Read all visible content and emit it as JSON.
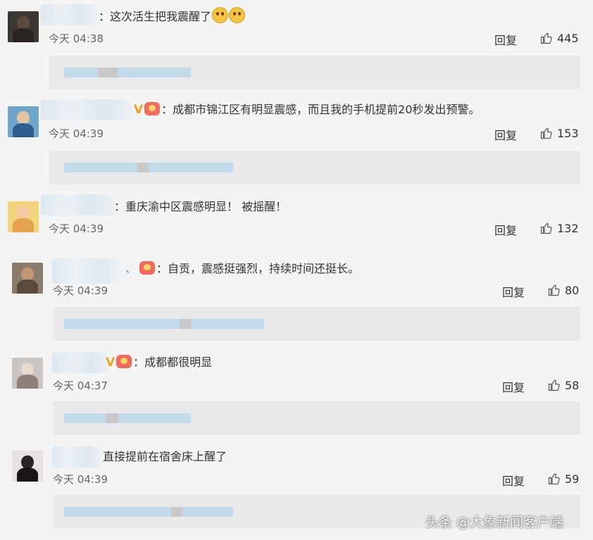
{
  "comments": [
    {
      "text": "：这次活生把我震醒了",
      "time": "今天 04:38",
      "reply": "回复",
      "likes": "445",
      "avatar_colors": [
        "#3d3732",
        "#5c4a3f",
        "#2a2420"
      ]
    },
    {
      "text": "：成都市锦江区有明显震感，而且我的手机提前20秒发出预警。",
      "time": "今天 04:39",
      "reply": "回复",
      "likes": "153",
      "avatar_colors": [
        "#6fa5c9",
        "#e2c3a3",
        "#2c5f8e"
      ]
    },
    {
      "text": "：重庆渝中区震感明显！ 被摇醒！",
      "time": "今天 04:39",
      "reply": "回复",
      "likes": "132",
      "avatar_colors": [
        "#f2d27a",
        "#f6c9a5",
        "#e6a44e"
      ]
    },
    {
      "prefix": "、",
      "text": "：自贡，震感挺强烈，持续时间还挺长。",
      "time": "今天 04:39",
      "reply": "回复",
      "likes": "80",
      "avatar_colors": [
        "#8c7b6a",
        "#c09770",
        "#5b4a3c"
      ]
    },
    {
      "text": "：成都都很明显",
      "time": "今天 04:37",
      "reply": "回复",
      "likes": "58",
      "avatar_colors": [
        "#c9c5c3",
        "#e8d8cf",
        "#8e7f79"
      ]
    },
    {
      "text": "直接提前在宿舍床上醒了",
      "time": "今天 04:39",
      "reply": "回复",
      "likes": "59",
      "avatar_colors": [
        "#e7e2e2",
        "#2a2325",
        "#1a1416"
      ]
    }
  ],
  "watermark": "头条 @大象新闻客户端",
  "colors": {
    "background": "#f4f4f4",
    "subreply_box": "#e9e9e9",
    "blur_blue": "#bcd9ea",
    "text": "#333333"
  },
  "icons": {
    "like": "thumbs-up-icon",
    "emoji": "crying-face-emoji",
    "vip": "v-badge-icon",
    "fan": "fan-badge-icon"
  }
}
